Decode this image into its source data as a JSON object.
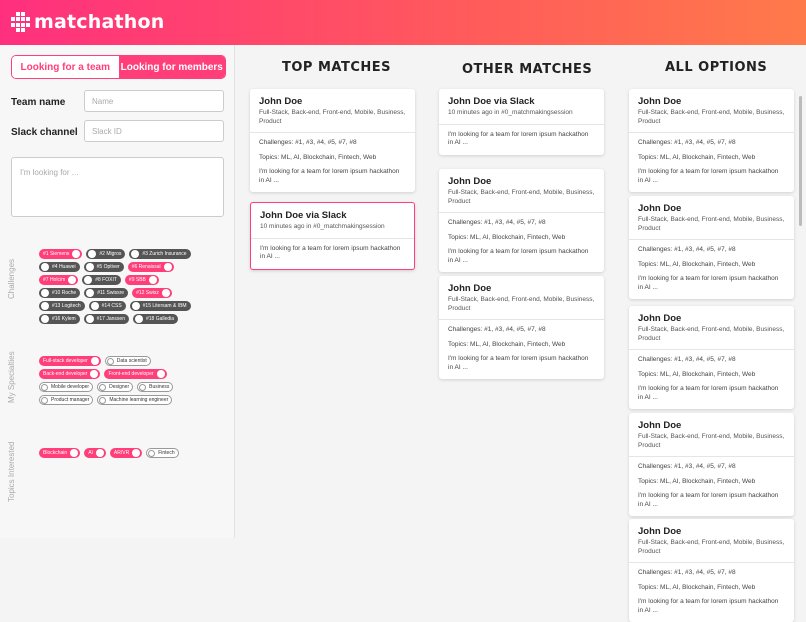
{
  "app": {
    "name": "matchathon"
  },
  "toggle": {
    "team": "Looking for a team",
    "members": "Looking for members"
  },
  "form": {
    "team_label": "Team name",
    "team_placeholder": "Name",
    "slack_label": "Slack channel",
    "slack_placeholder": "Slack ID",
    "looking_placeholder": "I'm looking for ..."
  },
  "sections": {
    "challenges": "Challenges",
    "specialties": "My Specialties",
    "topics": "Topics Interested"
  },
  "challenges": [
    {
      "label": "#1 Siemens",
      "on": true
    },
    {
      "label": "#2 Migros",
      "on": false
    },
    {
      "label": "#3 Zurich Insurance",
      "on": false
    },
    {
      "label": "#4 Huawei",
      "on": false
    },
    {
      "label": "#5 Optiver",
      "on": false
    },
    {
      "label": "#6 Renaissal",
      "on": true
    },
    {
      "label": "#7 Holcim",
      "on": true
    },
    {
      "label": "#8 FOXIT",
      "on": false
    },
    {
      "label": "#9 SBB",
      "on": true
    },
    {
      "label": "#10 Roche",
      "on": false
    },
    {
      "label": "#11 Swissre",
      "on": false
    },
    {
      "label": "#12 Swisz",
      "on": true
    },
    {
      "label": "#13 Logitech",
      "on": false
    },
    {
      "label": "#14 CSS",
      "on": false
    },
    {
      "label": "#15 Litersam & IBM",
      "on": false
    },
    {
      "label": "#16 Kylem",
      "on": false
    },
    {
      "label": "#17 Janssen",
      "on": false
    },
    {
      "label": "#18 Galledia",
      "on": false
    }
  ],
  "specialties": [
    {
      "label": "Full-stack developer",
      "on": true
    },
    {
      "label": "Data scientist",
      "on": false
    },
    {
      "label": "Back-end developer",
      "on": true
    },
    {
      "label": "Front-end developer",
      "on": true
    },
    {
      "label": "Mobile developer",
      "on": false
    },
    {
      "label": "Designer",
      "on": false
    },
    {
      "label": "Business",
      "on": false
    },
    {
      "label": "Product manager",
      "on": false
    },
    {
      "label": "Machine learning engineer",
      "on": false
    }
  ],
  "topics": [
    {
      "label": "Blockchain",
      "on": true
    },
    {
      "label": "AI",
      "on": true
    },
    {
      "label": "AR/VR",
      "on": true
    },
    {
      "label": "Fintech",
      "on": false
    }
  ],
  "columns": {
    "top": "TOP MATCHES",
    "other": "OTHER MATCHES",
    "all": "ALL OPTIONS"
  },
  "cards": {
    "person_name": "John Doe",
    "person_skills": "Full-Stack, Back-end, Front-end, Mobile, Business, Product",
    "challenges": "Challenges: #1, #3, #4, #5, #7, #8",
    "topics": "Topics: ML, AI, Blockchain, Fintech, Web",
    "looking": "I'm looking for a team for lorem ipsum hackathon in AI ...",
    "slack_name": "John Doe via Slack",
    "slack_meta": "10 minutes ago in #0_matchmakingsession"
  }
}
